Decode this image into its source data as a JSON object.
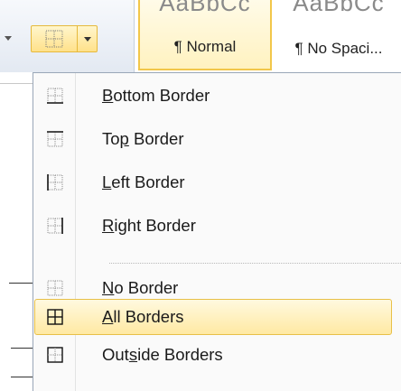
{
  "ribbon": {
    "styles": [
      {
        "preview": "AaBbCc",
        "label": "¶ Normal",
        "selected": true
      },
      {
        "preview": "AaBbCc",
        "label": "¶ No Spaci..."
      }
    ]
  },
  "menu": {
    "items": [
      {
        "pre": "",
        "key": "B",
        "post": "ottom Border",
        "icon": "bottom-border-icon"
      },
      {
        "pre": "To",
        "key": "p",
        "post": " Border",
        "icon": "top-border-icon"
      },
      {
        "pre": "",
        "key": "L",
        "post": "eft Border",
        "icon": "left-border-icon"
      },
      {
        "pre": "",
        "key": "R",
        "post": "ight Border",
        "icon": "right-border-icon"
      },
      {
        "pre": "",
        "key": "N",
        "post": "o Border",
        "icon": "no-border-icon"
      },
      {
        "pre": "",
        "key": "A",
        "post": "ll Borders",
        "icon": "all-borders-icon",
        "highlighted": true
      },
      {
        "pre": "Out",
        "key": "s",
        "post": "ide Borders",
        "icon": "outside-borders-icon"
      }
    ]
  },
  "colors": {
    "highlight_border": "#e8c048",
    "highlight_fill": "#ffe9a3"
  }
}
